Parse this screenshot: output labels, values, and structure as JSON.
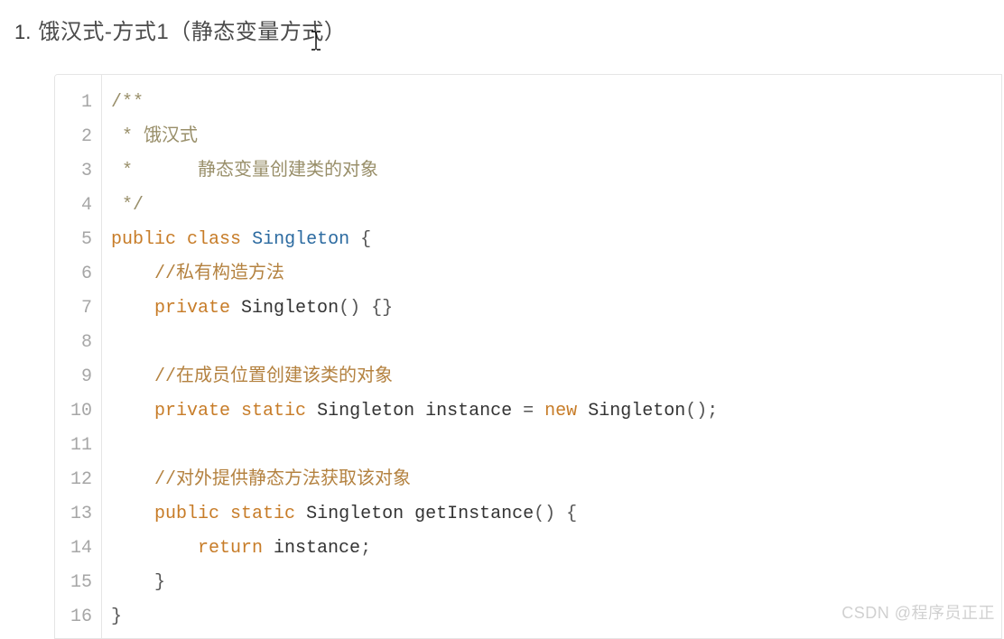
{
  "heading": {
    "number": "1.",
    "title": "饿汉式-方式1（静态变量方式）"
  },
  "code": {
    "lines": [
      {
        "num": "1",
        "segments": [
          {
            "cls": "tok-comment-block",
            "t": "/**"
          }
        ]
      },
      {
        "num": "2",
        "segments": [
          {
            "cls": "tok-comment-block",
            "t": " * 饿汉式"
          }
        ]
      },
      {
        "num": "3",
        "segments": [
          {
            "cls": "tok-comment-block",
            "t": " *      静态变量创建类的对象"
          }
        ]
      },
      {
        "num": "4",
        "segments": [
          {
            "cls": "tok-comment-block",
            "t": " */"
          }
        ]
      },
      {
        "num": "5",
        "segments": [
          {
            "cls": "tok-kw",
            "t": "public"
          },
          {
            "cls": "",
            "t": " "
          },
          {
            "cls": "tok-kw",
            "t": "class"
          },
          {
            "cls": "",
            "t": " "
          },
          {
            "cls": "tok-type",
            "t": "Singleton"
          },
          {
            "cls": "",
            "t": " "
          },
          {
            "cls": "tok-punc",
            "t": "{"
          }
        ]
      },
      {
        "num": "6",
        "segments": [
          {
            "cls": "",
            "t": "    "
          },
          {
            "cls": "tok-line-comment",
            "t": "//私有构造方法"
          }
        ]
      },
      {
        "num": "7",
        "segments": [
          {
            "cls": "",
            "t": "    "
          },
          {
            "cls": "tok-kw",
            "t": "private"
          },
          {
            "cls": "",
            "t": " "
          },
          {
            "cls": "tok-ident",
            "t": "Singleton"
          },
          {
            "cls": "tok-punc",
            "t": "()"
          },
          {
            "cls": "",
            "t": " "
          },
          {
            "cls": "tok-punc",
            "t": "{}"
          }
        ]
      },
      {
        "num": "8",
        "segments": [
          {
            "cls": "",
            "t": ""
          }
        ]
      },
      {
        "num": "9",
        "segments": [
          {
            "cls": "",
            "t": "    "
          },
          {
            "cls": "tok-line-comment",
            "t": "//在成员位置创建该类的对象"
          }
        ]
      },
      {
        "num": "10",
        "segments": [
          {
            "cls": "",
            "t": "    "
          },
          {
            "cls": "tok-kw",
            "t": "private"
          },
          {
            "cls": "",
            "t": " "
          },
          {
            "cls": "tok-kw",
            "t": "static"
          },
          {
            "cls": "",
            "t": " "
          },
          {
            "cls": "tok-ident",
            "t": "Singleton instance"
          },
          {
            "cls": "",
            "t": " "
          },
          {
            "cls": "tok-punc",
            "t": "="
          },
          {
            "cls": "",
            "t": " "
          },
          {
            "cls": "tok-kw",
            "t": "new"
          },
          {
            "cls": "",
            "t": " "
          },
          {
            "cls": "tok-ident",
            "t": "Singleton"
          },
          {
            "cls": "tok-punc",
            "t": "();"
          }
        ]
      },
      {
        "num": "11",
        "segments": [
          {
            "cls": "",
            "t": ""
          }
        ]
      },
      {
        "num": "12",
        "segments": [
          {
            "cls": "",
            "t": "    "
          },
          {
            "cls": "tok-line-comment",
            "t": "//对外提供静态方法获取该对象"
          }
        ]
      },
      {
        "num": "13",
        "segments": [
          {
            "cls": "",
            "t": "    "
          },
          {
            "cls": "tok-kw",
            "t": "public"
          },
          {
            "cls": "",
            "t": " "
          },
          {
            "cls": "tok-kw",
            "t": "static"
          },
          {
            "cls": "",
            "t": " "
          },
          {
            "cls": "tok-ident",
            "t": "Singleton "
          },
          {
            "cls": "tok-method",
            "t": "getInstance"
          },
          {
            "cls": "tok-punc",
            "t": "()"
          },
          {
            "cls": "",
            "t": " "
          },
          {
            "cls": "tok-punc",
            "t": "{"
          }
        ]
      },
      {
        "num": "14",
        "segments": [
          {
            "cls": "",
            "t": "        "
          },
          {
            "cls": "tok-kw",
            "t": "return"
          },
          {
            "cls": "",
            "t": " "
          },
          {
            "cls": "tok-ident",
            "t": "instance"
          },
          {
            "cls": "tok-punc",
            "t": ";"
          }
        ]
      },
      {
        "num": "15",
        "segments": [
          {
            "cls": "",
            "t": "    "
          },
          {
            "cls": "tok-punc",
            "t": "}"
          }
        ]
      },
      {
        "num": "16",
        "segments": [
          {
            "cls": "tok-punc",
            "t": "}"
          }
        ]
      }
    ]
  },
  "watermark": "CSDN @程序员正正"
}
